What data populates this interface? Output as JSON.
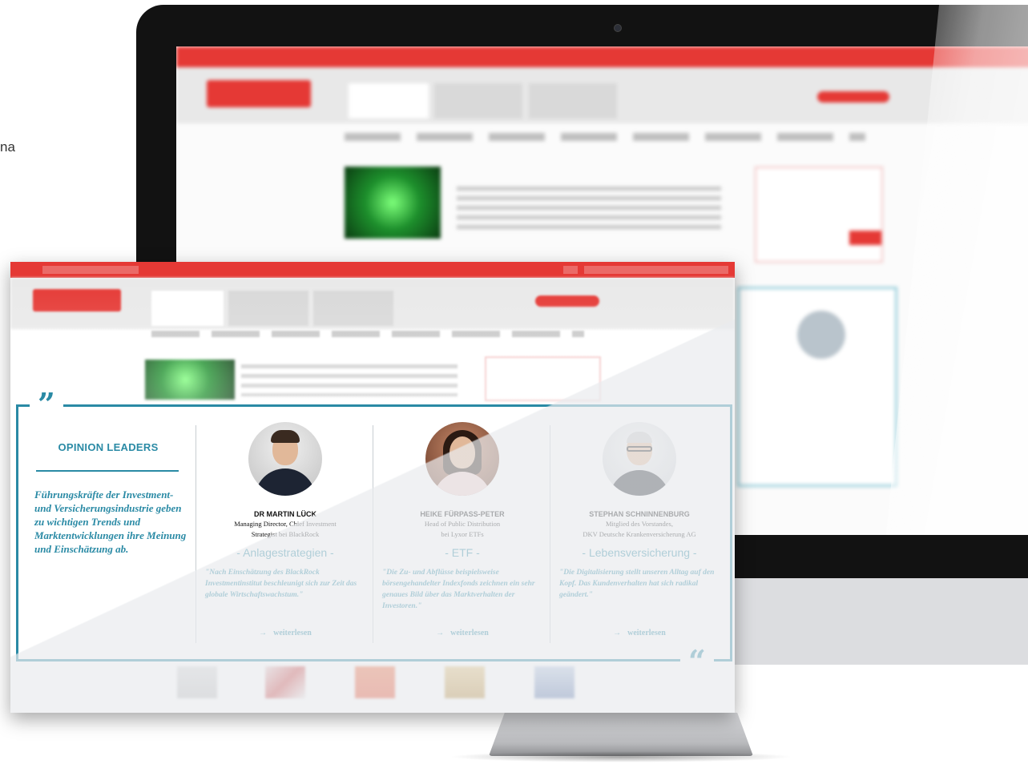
{
  "stray_heading_fragment": "na",
  "opinion_leaders": {
    "open_quote": "”",
    "close_quote": "“",
    "title": "OPINION LEADERS",
    "intro": "Führungskräfte der Investment- und Versicherungsindustrie geben zu wichtigen Trends und Marktentwicklungen ihre Meinung und Einschätzung ab.",
    "people": [
      {
        "name": "DR MARTIN LÜCK",
        "role_line1": "Managing Director, Chief Investment",
        "role_line2": "Strategist bei BlackRock",
        "topic": "- Anlagestrategien -",
        "quote": "\"Nach Einschätzung des BlackRock Investmentinstitut beschleunigt sich zur Zeit das globale Wirtschaftswachstum.\"",
        "link_label": "weiterlesen"
      },
      {
        "name": "HEIKE FÜRPASS-PETER",
        "role_line1": "Head of Public Distribution",
        "role_line2": "bei Lyxor ETFs",
        "topic": "- ETF -",
        "quote": "\"Die Zu- und Abflüsse beispielsweise börsengehandelter Indexfonds zeichnen ein sehr genaues Bild über das Marktverhalten der Investoren.\"",
        "link_label": "weiterlesen"
      },
      {
        "name": "STEPHAN SCHNINNENBURG",
        "role_line1": "Mitglied des Vorstandes,",
        "role_line2": "DKV Deutsche Krankenversicherung AG",
        "topic": "- Lebensversicherung -",
        "quote": "\"Die Digitalisierung stellt unseren Alltag auf den Kopf. Das Kundenverhalten hat sich radikal geändert.\"",
        "link_label": "weiterlesen"
      }
    ]
  },
  "icons": {
    "arrow": "→"
  },
  "colors": {
    "brand_red": "#e53935",
    "accent_teal": "#2a8aa5"
  }
}
